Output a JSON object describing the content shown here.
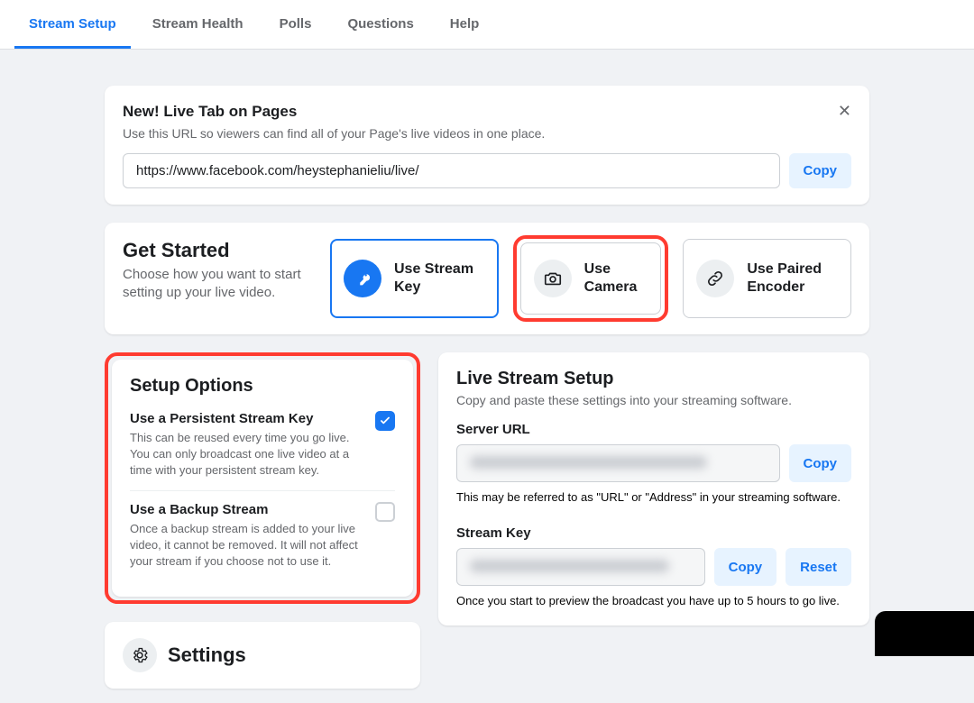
{
  "tabs": {
    "items": [
      {
        "label": "Stream Setup",
        "active": true
      },
      {
        "label": "Stream Health",
        "active": false
      },
      {
        "label": "Polls",
        "active": false
      },
      {
        "label": "Questions",
        "active": false
      },
      {
        "label": "Help",
        "active": false
      }
    ]
  },
  "banner": {
    "title": "New! Live Tab on Pages",
    "subtitle": "Use this URL so viewers can find all of your Page's live videos in one place.",
    "url": "https://www.facebook.com/heystephanieliu/live/",
    "copy_label": "Copy"
  },
  "get_started": {
    "title": "Get Started",
    "subtitle": "Choose how you want to start setting up your live video.",
    "options": [
      {
        "label": "Use Stream Key",
        "icon": "key-icon",
        "selected": true,
        "highlighted": false
      },
      {
        "label": "Use Camera",
        "icon": "camera-icon",
        "selected": false,
        "highlighted": true
      },
      {
        "label": "Use Paired Encoder",
        "icon": "link-icon",
        "selected": false,
        "highlighted": false
      }
    ]
  },
  "setup_options": {
    "title": "Setup Options",
    "items": [
      {
        "title": "Use a Persistent Stream Key",
        "desc": "This can be reused every time you go live. You can only broadcast one live video at a time with your persistent stream key.",
        "checked": true
      },
      {
        "title": "Use a Backup Stream",
        "desc": "Once a backup stream is added to your live video, it cannot be removed. It will not affect your stream if you choose not to use it.",
        "checked": false
      }
    ]
  },
  "live_setup": {
    "title": "Live Stream Setup",
    "subtitle": "Copy and paste these settings into your streaming software.",
    "server_url_label": "Server URL",
    "server_url_note": "This may be referred to as \"URL\" or \"Address\" in your streaming software.",
    "stream_key_label": "Stream Key",
    "stream_key_note": "Once you start to preview the broadcast you have up to 5 hours to go live.",
    "copy_label": "Copy",
    "reset_label": "Reset"
  },
  "settings": {
    "title": "Settings"
  }
}
